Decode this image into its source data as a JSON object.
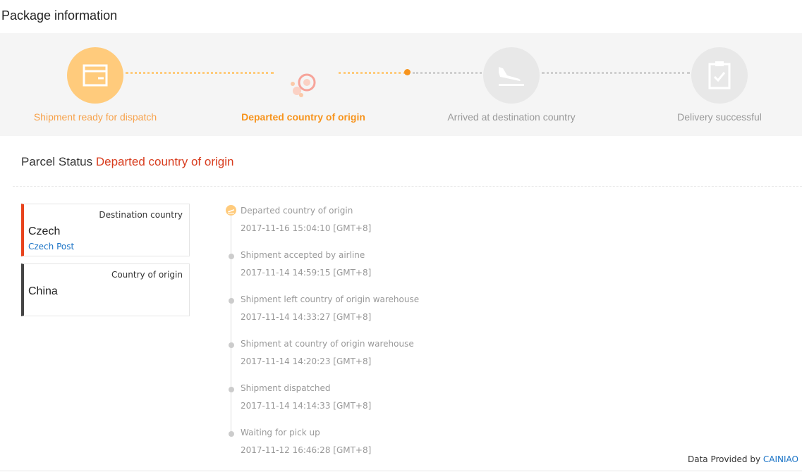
{
  "page": {
    "title": "Package information"
  },
  "steps": [
    {
      "label": "Shipment ready for dispatch",
      "icon": "box-icon",
      "state": "done"
    },
    {
      "label": "Departed country of origin",
      "icon": "stamp-icon",
      "state": "current"
    },
    {
      "label": "Arrived at destination country",
      "icon": "plane-landing-icon",
      "state": "pending"
    },
    {
      "label": "Delivery successful",
      "icon": "clipboard-check-icon",
      "state": "pending"
    }
  ],
  "status": {
    "prefix": "Parcel Status",
    "value": "Departed country of origin"
  },
  "destination": {
    "type": "Destination country",
    "name": "Czech",
    "carrier": "Czech Post"
  },
  "origin": {
    "type": "Country of origin",
    "name": "China"
  },
  "events": [
    {
      "desc": "Departed country of origin",
      "time": "2017-11-16 15:04:10 [GMT+8]"
    },
    {
      "desc": "Shipment accepted by airline",
      "time": "2017-11-14 14:59:15 [GMT+8]"
    },
    {
      "desc": "Shipment left country of origin warehouse",
      "time": "2017-11-14 14:33:27 [GMT+8]"
    },
    {
      "desc": "Shipment at country of origin warehouse",
      "time": "2017-11-14 14:20:23 [GMT+8]"
    },
    {
      "desc": "Shipment dispatched",
      "time": "2017-11-14 14:14:33 [GMT+8]"
    },
    {
      "desc": "Waiting for pick up",
      "time": "2017-11-12 16:46:28 [GMT+8]"
    }
  ],
  "footer": {
    "prefix": "Data Provided by",
    "provider": "CAINIAO"
  },
  "colors": {
    "accent": "#f7941d",
    "accent_light": "#ffcb7c",
    "status_red": "#d83c1e",
    "link": "#1a73c6"
  }
}
